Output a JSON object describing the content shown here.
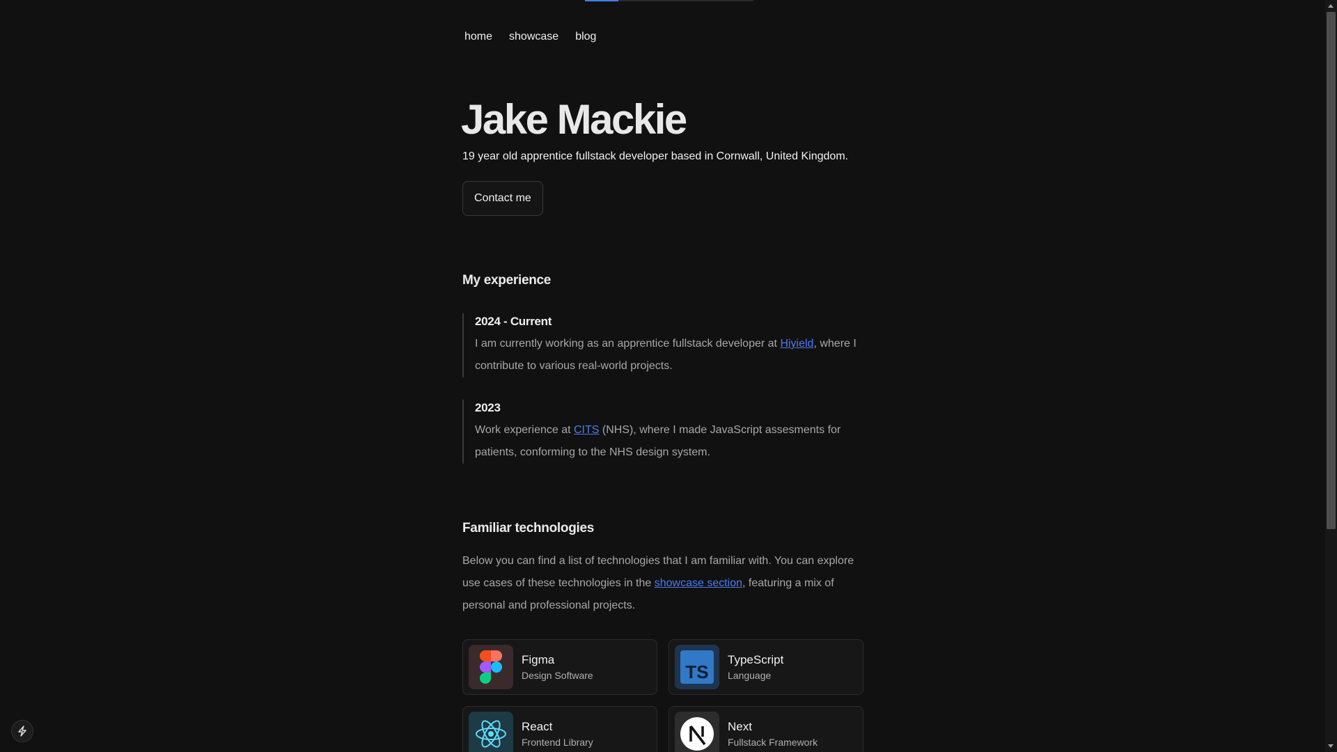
{
  "nav": {
    "items": [
      {
        "label": "home"
      },
      {
        "label": "showcase"
      },
      {
        "label": "blog"
      }
    ]
  },
  "hero": {
    "name": "Jake Mackie",
    "subtitle": "19 year old apprentice fullstack developer based in Cornwall, United Kingdom.",
    "contact_label": "Contact me"
  },
  "experience": {
    "title": "My experience",
    "items": [
      {
        "year": "2024 - Current",
        "before": "I am currently working as an apprentice fullstack developer at ",
        "link": "Hiyield",
        "after": ", where I contribute to various real-world projects."
      },
      {
        "year": "2023",
        "before": "Work experience at ",
        "link": "CITS",
        "after": " (NHS), where I made JavaScript assesments for patients, conforming to the NHS design system."
      }
    ]
  },
  "technologies": {
    "title": "Familiar technologies",
    "intro_before": "Below you can find a list of technologies that I am familiar with. You can explore use cases of these technologies in the ",
    "intro_link": "showcase section",
    "intro_after": ", featuring a mix of personal and professional projects.",
    "items": [
      {
        "name": "Figma",
        "category": "Design Software",
        "icon": "figma-icon"
      },
      {
        "name": "TypeScript",
        "category": "Language",
        "icon": "typescript-icon"
      },
      {
        "name": "React",
        "category": "Frontend Library",
        "icon": "react-icon"
      },
      {
        "name": "Next",
        "category": "Fullstack Framework",
        "icon": "nextjs-icon"
      }
    ]
  },
  "colors": {
    "background": "#111111",
    "link": "#4a7cf5",
    "accent": "#3b82f6"
  }
}
